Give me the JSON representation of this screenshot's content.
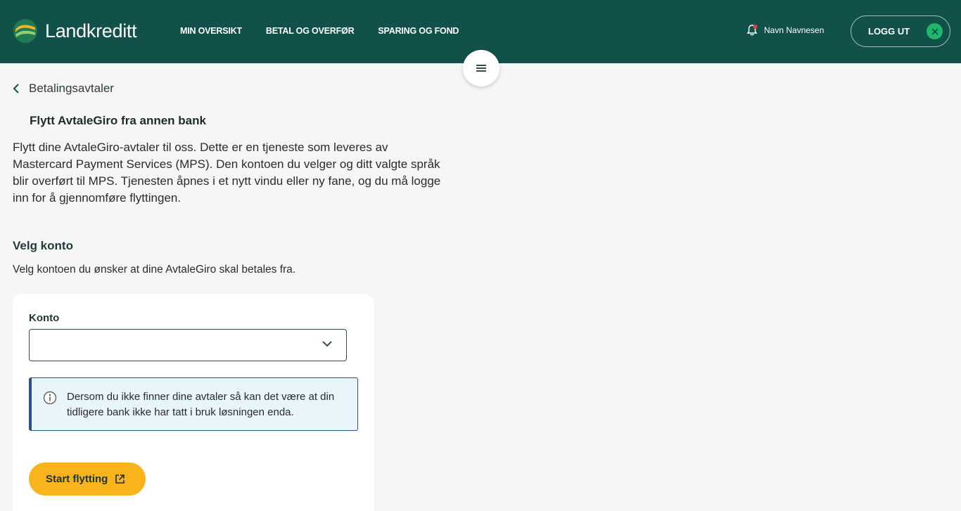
{
  "header": {
    "brand": "Landkreditt",
    "nav": [
      "MIN OVERSIKT",
      "BETAL OG OVERFØR",
      "SPARING OG FOND"
    ],
    "user_name": "Navn Navnesen",
    "logout_label": "LOGG UT"
  },
  "colors": {
    "header_bg": "#12504a",
    "logout_accent": "#1fb86b",
    "primary_button": "#f8b41a",
    "info_bg": "#e8f5fb",
    "info_border": "#2a4f8a",
    "notification_dot": "#e0403a"
  },
  "icons": {
    "menu": "hamburger-icon",
    "back": "chevron-left-icon",
    "bell": "bell-icon",
    "logout": "close-icon",
    "select": "chevron-down-icon",
    "info": "info-icon",
    "external": "external-link-icon"
  },
  "main": {
    "back_label": "Betalingsavtaler",
    "title": "Flytt AvtaleGiro fra annen bank",
    "intro": "Flytt dine AvtaleGiro-avtaler til oss. Dette er en tjeneste som leveres av Mastercard Payment Services (MPS). Den kontoen du velger og ditt valgte språk blir overført til MPS. Tjenesten åpnes i et nytt vindu eller ny fane, og du må logge inn for å gjennomføre flyttingen.",
    "section_title": "Velg konto",
    "section_desc": "Velg kontoen du ønsker at dine AvtaleGiro skal betales fra.",
    "account_label": "Konto",
    "account_value": "",
    "info_text": "Dersom du ikke finner dine avtaler så kan det være at din tidligere bank ikke har tatt i bruk løsningen enda.",
    "start_label": "Start flytting"
  }
}
